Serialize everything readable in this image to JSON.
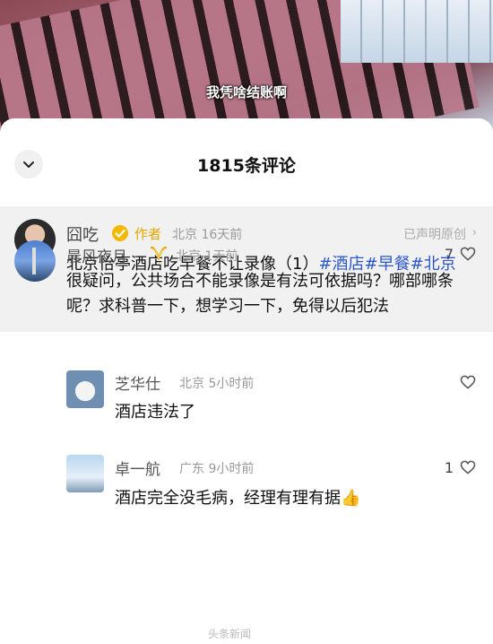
{
  "video": {
    "subtitle": "我凭啥结账啊"
  },
  "sheet": {
    "title": "1815条评论"
  },
  "author_comment": {
    "name": "囧吃",
    "tag": "作者",
    "meta": "北京 16天前",
    "claim": "已声明原创",
    "text": "北京怡亭酒店吃早餐不让录像（1）",
    "hashtags": [
      "#酒店",
      "#早餐",
      "#北京"
    ]
  },
  "comments": [
    {
      "name": "晨风夜月",
      "meta": "北京 1天前",
      "likes": "7",
      "text": "很疑问，公共场合不能录像是有法可依据吗？哪部哪条呢？求科普一下，想学习一下，免得以后犯法",
      "replies": [
        {
          "name": "芝华仕",
          "meta": "北京 5小时前",
          "likes": "",
          "text": "酒店违法了"
        },
        {
          "name": "卓一航",
          "meta": "广东 9小时前",
          "likes": "1",
          "text": "酒店完全没毛病，经理有理有据👍"
        }
      ]
    }
  ],
  "watermark": "头条新闻",
  "colors": {
    "hashtag": "#2b57c8",
    "author_tag": "#e0a800",
    "author_bg": "#f1f1f1"
  }
}
